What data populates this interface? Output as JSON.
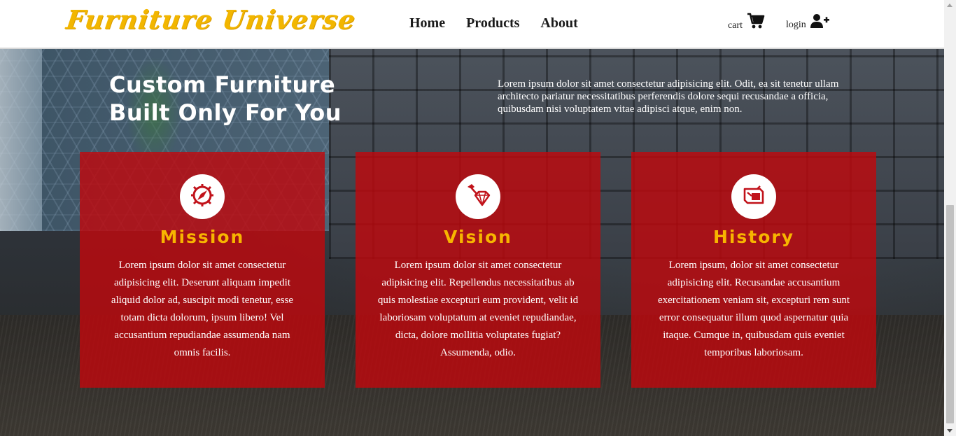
{
  "navbar": {
    "logo": "Furniture Universe",
    "links": [
      "Home",
      "Products",
      "About"
    ],
    "cart_label": "cart",
    "login_label": "login"
  },
  "hero": {
    "title_line1": "Custom Furniture",
    "title_line2": "Built Only For You",
    "text": "Lorem ipsum dolor sit amet consectetur adipisicing elit. Odit, ea sit tenetur ullam architecto pariatur necessitatibus perferendis dolore sequi recusandae a officia, quibusdam nisi voluptatem vitae adipisci atque, enim non."
  },
  "cards": [
    {
      "title": "Mission",
      "icon": "compass-icon",
      "text": "Lorem ipsum dolor sit amet consectetur adipisicing elit. Deserunt aliquam impedit aliquid dolor ad, suscipit modi tenetur, esse totam dicta dolorum, ipsum libero! Vel accusantium repudiandae assumenda nam omnis facilis."
    },
    {
      "title": "Vision",
      "icon": "gem-hammer-icon",
      "text": "Lorem ipsum dolor sit amet consectetur adipisicing elit. Repellendus necessitatibus ab quis molestiae excepturi eum provident, velit id laboriosam voluptatum at eveniet repudiandae, dicta, dolore mollitia voluptates fugiat? Assumenda, odio."
    },
    {
      "title": "History",
      "icon": "history-icon",
      "text": "Lorem ipsum, dolor sit amet consectetur adipisicing elit. Recusandae accusantium exercitationem veniam sit, excepturi rem sunt error consequatur illum quod aspernatur quia itaque. Cumque in, quibusdam quis eveniet temporibus laboriosam."
    }
  ],
  "colors": {
    "brand_yellow": "#f2b600",
    "card_red": "#be080e",
    "card_title": "#f7b500"
  }
}
